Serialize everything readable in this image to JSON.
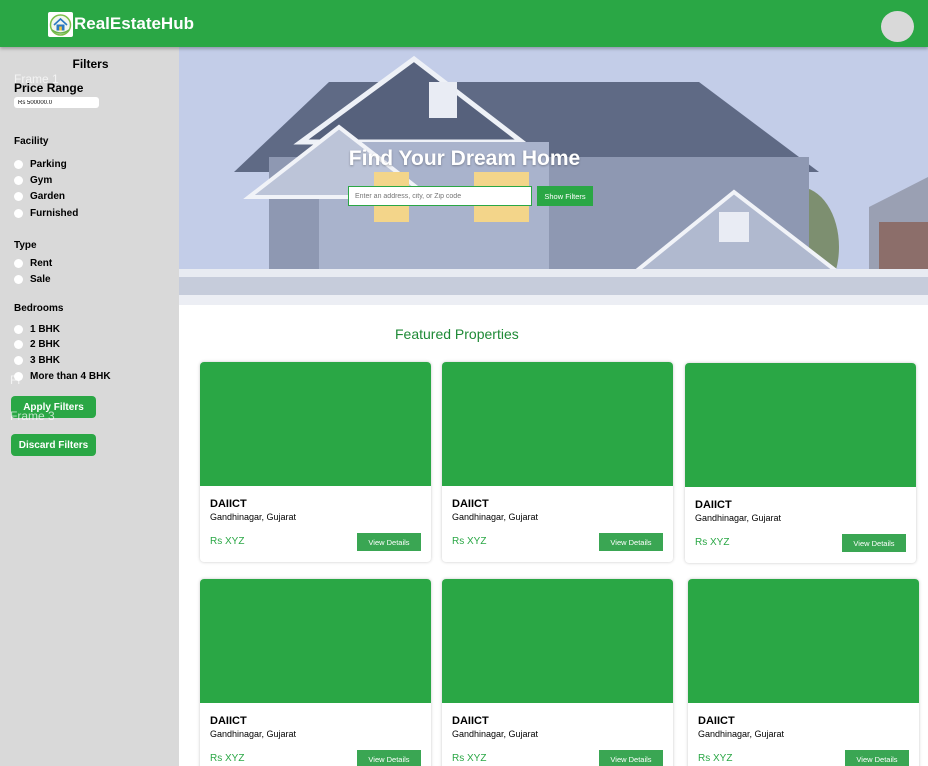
{
  "header": {
    "brand": "RealEstateHub"
  },
  "sidebar": {
    "title": "Filters",
    "ghost_frame1": "Frame 1",
    "ghost_frame2": "Fr",
    "ghost_frame3": "Frame 3",
    "price_label": "Price Range",
    "price_value": "Rs 500000.0",
    "facility_title": "Facility",
    "facility": [
      "Parking",
      "Gym",
      "Garden",
      "Furnished"
    ],
    "type_title": "Type",
    "type": [
      "Rent",
      "Sale"
    ],
    "bedrooms_title": "Bedrooms",
    "bedrooms": [
      "1 BHK",
      "2 BHK",
      "3 BHK",
      "More than 4 BHK"
    ],
    "apply_label": "Apply Filters",
    "discard_label": "Discard Filters"
  },
  "hero": {
    "title": "Find Your Dream Home",
    "search_placeholder": "Enter an address, city, or Zip code",
    "button_label": "Show Filters"
  },
  "featured": {
    "title": "Featured Properties",
    "cards": [
      {
        "name": "DAIICT",
        "location": "Gandhinagar, Gujarat",
        "price": "Rs XYZ",
        "button": "View Details"
      },
      {
        "name": "DAIICT",
        "location": "Gandhinagar, Gujarat",
        "price": "Rs XYZ",
        "button": "View Details"
      },
      {
        "name": "DAIICT",
        "location": "Gandhinagar, Gujarat",
        "price": "Rs XYZ",
        "button": "View Details"
      },
      {
        "name": "DAIICT",
        "location": "Gandhinagar, Gujarat",
        "price": "Rs XYZ",
        "button": "View Details"
      },
      {
        "name": "DAIICT",
        "location": "Gandhinagar, Gujarat",
        "price": "Rs XYZ",
        "button": "View Details"
      },
      {
        "name": "DAIICT",
        "location": "Gandhinagar, Gujarat",
        "price": "Rs XYZ",
        "button": "View Details"
      }
    ]
  },
  "colors": {
    "brand_green": "#2aa745",
    "sidebar_gray": "#d9d9d9",
    "title_green": "#1e8a36"
  },
  "icons": {
    "logo": "house-logo-icon",
    "avatar": "user-avatar"
  }
}
